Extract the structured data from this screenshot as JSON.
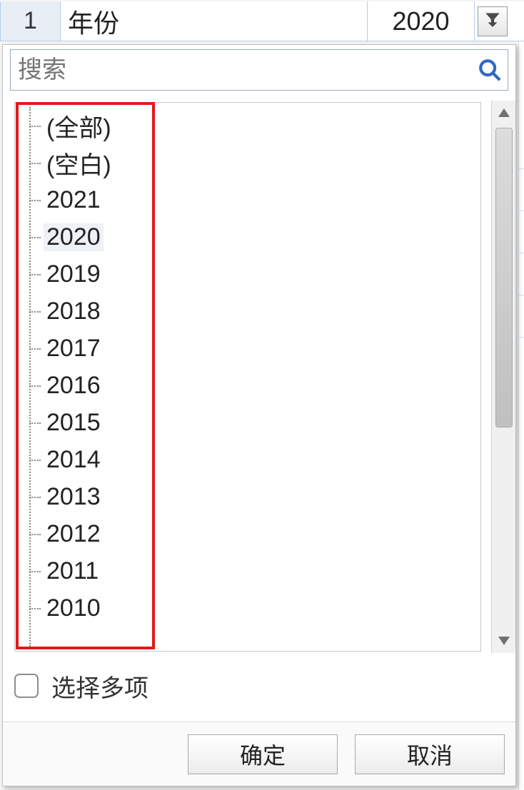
{
  "sheet": {
    "row_num": "1",
    "field_label": "年份",
    "current_value": "2020"
  },
  "search": {
    "placeholder": "搜索"
  },
  "list": {
    "items": [
      {
        "label": "(全部)",
        "selected": false
      },
      {
        "label": "(空白)",
        "selected": false
      },
      {
        "label": "2021",
        "selected": false
      },
      {
        "label": "2020",
        "selected": true
      },
      {
        "label": "2019",
        "selected": false
      },
      {
        "label": "2018",
        "selected": false
      },
      {
        "label": "2017",
        "selected": false
      },
      {
        "label": "2016",
        "selected": false
      },
      {
        "label": "2015",
        "selected": false
      },
      {
        "label": "2014",
        "selected": false
      },
      {
        "label": "2013",
        "selected": false
      },
      {
        "label": "2012",
        "selected": false
      },
      {
        "label": "2011",
        "selected": false
      },
      {
        "label": "2010",
        "selected": false
      }
    ]
  },
  "multi": {
    "label": "选择多项"
  },
  "buttons": {
    "ok": "确定",
    "cancel": "取消"
  }
}
